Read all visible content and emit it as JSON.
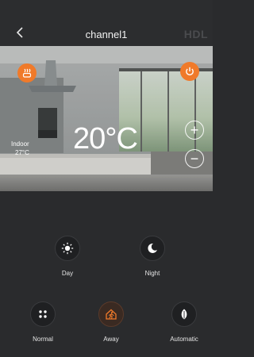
{
  "header": {
    "title": "channel1",
    "brand": "HDL"
  },
  "hero": {
    "indoor_label": "Indoor",
    "indoor_temp": "27°C",
    "set_temp": "20°C",
    "plus": "+",
    "minus": "−"
  },
  "modes": [
    {
      "label": "Day",
      "icon": "sun-icon"
    },
    {
      "label": "Night",
      "icon": "moon-icon"
    },
    {
      "label": "Normal",
      "icon": "dots-icon"
    },
    {
      "label": "Away",
      "icon": "away-icon",
      "active": true
    },
    {
      "label": "Automatic",
      "icon": "leaf-icon"
    }
  ],
  "colors": {
    "accent": "#f07a2a",
    "background": "#2a2b2d"
  }
}
